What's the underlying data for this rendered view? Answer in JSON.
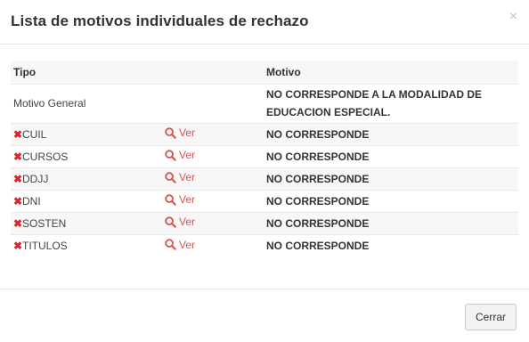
{
  "dialog": {
    "title": "Lista de motivos individuales de rechazo",
    "close_symbol": "×"
  },
  "table": {
    "headers": {
      "tipo": "Tipo",
      "ver": "",
      "motivo": "Motivo"
    },
    "general_row": {
      "tipo": "Motivo General",
      "motivo_line1": "NO CORRESPONDE A LA MODALIDAD DE",
      "motivo_line2": "EDUCACION ESPECIAL."
    },
    "rows": [
      {
        "tipo": "CUIL",
        "ver": "Ver",
        "motivo": "NO CORRESPONDE"
      },
      {
        "tipo": "CURSOS",
        "ver": "Ver",
        "motivo": "NO CORRESPONDE"
      },
      {
        "tipo": "DDJJ",
        "ver": "Ver",
        "motivo": "NO CORRESPONDE"
      },
      {
        "tipo": "DNI",
        "ver": "Ver",
        "motivo": "NO CORRESPONDE"
      },
      {
        "tipo": "SOSTEN",
        "ver": "Ver",
        "motivo": "NO CORRESPONDE"
      },
      {
        "tipo": "TITULOS",
        "ver": "Ver",
        "motivo": "NO CORRESPONDE"
      }
    ],
    "reject_icon": "x-mark-icon",
    "ver_icon": "search-icon"
  },
  "footer": {
    "close_label": "Cerrar"
  },
  "colors": {
    "accent_red": "#d9534f",
    "reject_red": "#d9262a"
  }
}
